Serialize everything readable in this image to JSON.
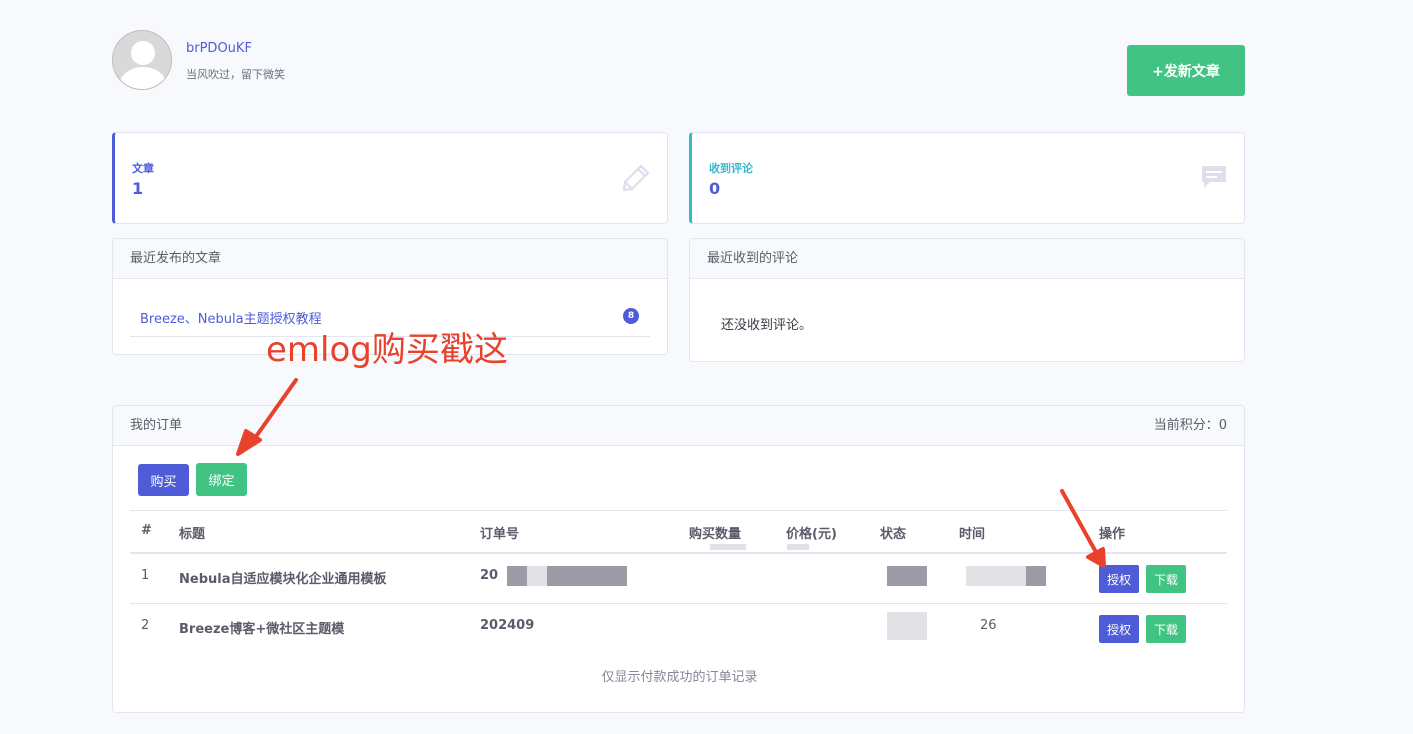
{
  "profile": {
    "username": "brPDOuKF",
    "motto": "当风吹过，留下微笑",
    "new_post_label": "+发新文章"
  },
  "stats": {
    "articles": {
      "label": "文章",
      "value": "1"
    },
    "comments": {
      "label": "收到评论",
      "value": "0"
    }
  },
  "recent_posts": {
    "title": "最近发布的文章",
    "items": [
      {
        "title": "Breeze、Nebula主题授权教程",
        "count": "8"
      }
    ]
  },
  "recent_comments": {
    "title": "最近收到的评论",
    "empty_text": "还没收到评论。"
  },
  "orders": {
    "title": "我的订单",
    "points_label": "当前积分：0",
    "buy_label": "购买",
    "bind_label": "绑定",
    "columns": [
      "#",
      "标题",
      "订单号",
      "购买数量",
      "价格(元)",
      "状态",
      "时间",
      "操作"
    ],
    "rows": [
      {
        "num": "1",
        "title": "Nebula自适应模块化企业通用模板",
        "order_no": "20",
        "auth_label": "授权",
        "download_label": "下载"
      },
      {
        "num": "2",
        "title": "Breeze博客+微社区主题模",
        "order_no": "202409",
        "time": "26",
        "auth_label": "授权",
        "download_label": "下载"
      }
    ],
    "footnote": "仅显示付款成功的订单记录"
  },
  "annotation": {
    "text": "emlog购买戳这",
    "color": "#e8412c"
  },
  "colors": {
    "primary": "#4e5cd8",
    "success": "#41c483",
    "info": "#36b9cc"
  }
}
